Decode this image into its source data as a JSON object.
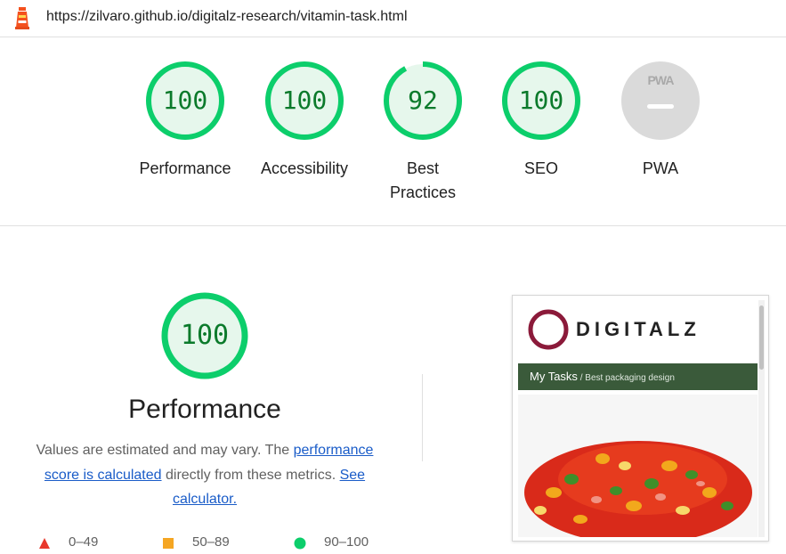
{
  "url": "https://zilvaro.github.io/digitalz-research/vitamin-task.html",
  "gauges": [
    {
      "label": "Performance",
      "score": "100",
      "fraction": 1.0
    },
    {
      "label": "Accessibility",
      "score": "100",
      "fraction": 1.0
    },
    {
      "label_line1": "Best",
      "label_line2": "Practices",
      "score": "92",
      "fraction": 0.92
    },
    {
      "label": "SEO",
      "score": "100",
      "fraction": 1.0
    },
    {
      "label": "PWA",
      "badge_text": "PWA"
    }
  ],
  "performance": {
    "score": "100",
    "title": "Performance",
    "desc_prefix": "Values are estimated and may vary. The ",
    "link_score": "performance score is calculated",
    "desc_middle": " directly from these metrics. ",
    "link_calc": "See calculator."
  },
  "legend": [
    {
      "range": "0–49",
      "color": "#e8382c",
      "shape": "triangle-icon"
    },
    {
      "range": "50–89",
      "color": "#f5a623",
      "shape": "square-icon"
    },
    {
      "range": "90–100",
      "color": "#0cce6b",
      "shape": "circle-icon"
    }
  ],
  "thumbnail": {
    "brand": "DIGITALZ",
    "nav_main": "My Tasks",
    "nav_sub": " / Best packaging design"
  },
  "colors": {
    "pass_ring": "#0cce6b",
    "pass_fill": "#e6f7ec",
    "pass_text": "#0b7a2b",
    "pwa_gray": "#dadada"
  }
}
